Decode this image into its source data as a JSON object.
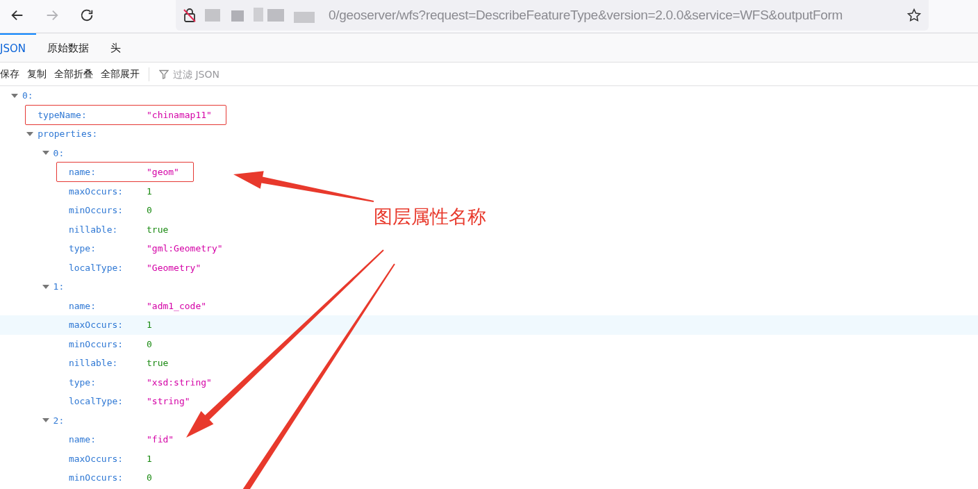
{
  "browser": {
    "back_enabled": true,
    "forward_enabled": false,
    "url": "0/geoserver/wfs?request=DescribeFeatureType&version=2.0.0&service=WFS&outputForm"
  },
  "tabs": [
    {
      "label": "JSON",
      "selected": true
    },
    {
      "label": "原始数据",
      "selected": false
    },
    {
      "label": "头",
      "selected": false
    }
  ],
  "toolbar": {
    "buttons": [
      "保存",
      "复制",
      "全部折叠",
      "全部展开"
    ],
    "filter": {
      "placeholder": "过滤 JSON"
    }
  },
  "tree": [
    {
      "key": "0:",
      "expanded": true,
      "boxed": false,
      "hovered": false,
      "children": [
        {
          "key": "typeName:",
          "value": "\"chinamap11\"",
          "kind": "string",
          "boxed": true,
          "hovered": false
        },
        {
          "key": "properties:",
          "expanded": true,
          "boxed": false,
          "hovered": false,
          "children": [
            {
              "key": "0:",
              "expanded": true,
              "boxed": false,
              "hovered": false,
              "children": [
                {
                  "key": "name:",
                  "value": "\"geom\"",
                  "kind": "string",
                  "boxed": true,
                  "hovered": false
                },
                {
                  "key": "maxOccurs:",
                  "value": "1",
                  "kind": "number",
                  "boxed": false,
                  "hovered": false
                },
                {
                  "key": "minOccurs:",
                  "value": "0",
                  "kind": "number",
                  "boxed": false,
                  "hovered": false
                },
                {
                  "key": "nillable:",
                  "value": "true",
                  "kind": "boolean",
                  "boxed": false,
                  "hovered": false
                },
                {
                  "key": "type:",
                  "value": "\"gml:Geometry\"",
                  "kind": "string",
                  "boxed": false,
                  "hovered": false
                },
                {
                  "key": "localType:",
                  "value": "\"Geometry\"",
                  "kind": "string",
                  "boxed": false,
                  "hovered": false
                }
              ]
            },
            {
              "key": "1:",
              "expanded": true,
              "boxed": false,
              "hovered": false,
              "children": [
                {
                  "key": "name:",
                  "value": "\"adm1_code\"",
                  "kind": "string",
                  "boxed": false,
                  "hovered": false
                },
                {
                  "key": "maxOccurs:",
                  "value": "1",
                  "kind": "number",
                  "boxed": false,
                  "hovered": true
                },
                {
                  "key": "minOccurs:",
                  "value": "0",
                  "kind": "number",
                  "boxed": false,
                  "hovered": false
                },
                {
                  "key": "nillable:",
                  "value": "true",
                  "kind": "boolean",
                  "boxed": false,
                  "hovered": false
                },
                {
                  "key": "type:",
                  "value": "\"xsd:string\"",
                  "kind": "string",
                  "boxed": false,
                  "hovered": false
                },
                {
                  "key": "localType:",
                  "value": "\"string\"",
                  "kind": "string",
                  "boxed": false,
                  "hovered": false
                }
              ]
            },
            {
              "key": "2:",
              "expanded": true,
              "boxed": false,
              "hovered": false,
              "children": [
                {
                  "key": "name:",
                  "value": "\"fid\"",
                  "kind": "string",
                  "boxed": false,
                  "hovered": false
                },
                {
                  "key": "maxOccurs:",
                  "value": "1",
                  "kind": "number",
                  "boxed": false,
                  "hovered": false
                },
                {
                  "key": "minOccurs:",
                  "value": "0",
                  "kind": "number",
                  "boxed": false,
                  "hovered": false
                }
              ]
            }
          ]
        }
      ]
    }
  ],
  "annotation": {
    "label": "图层属性名称"
  }
}
